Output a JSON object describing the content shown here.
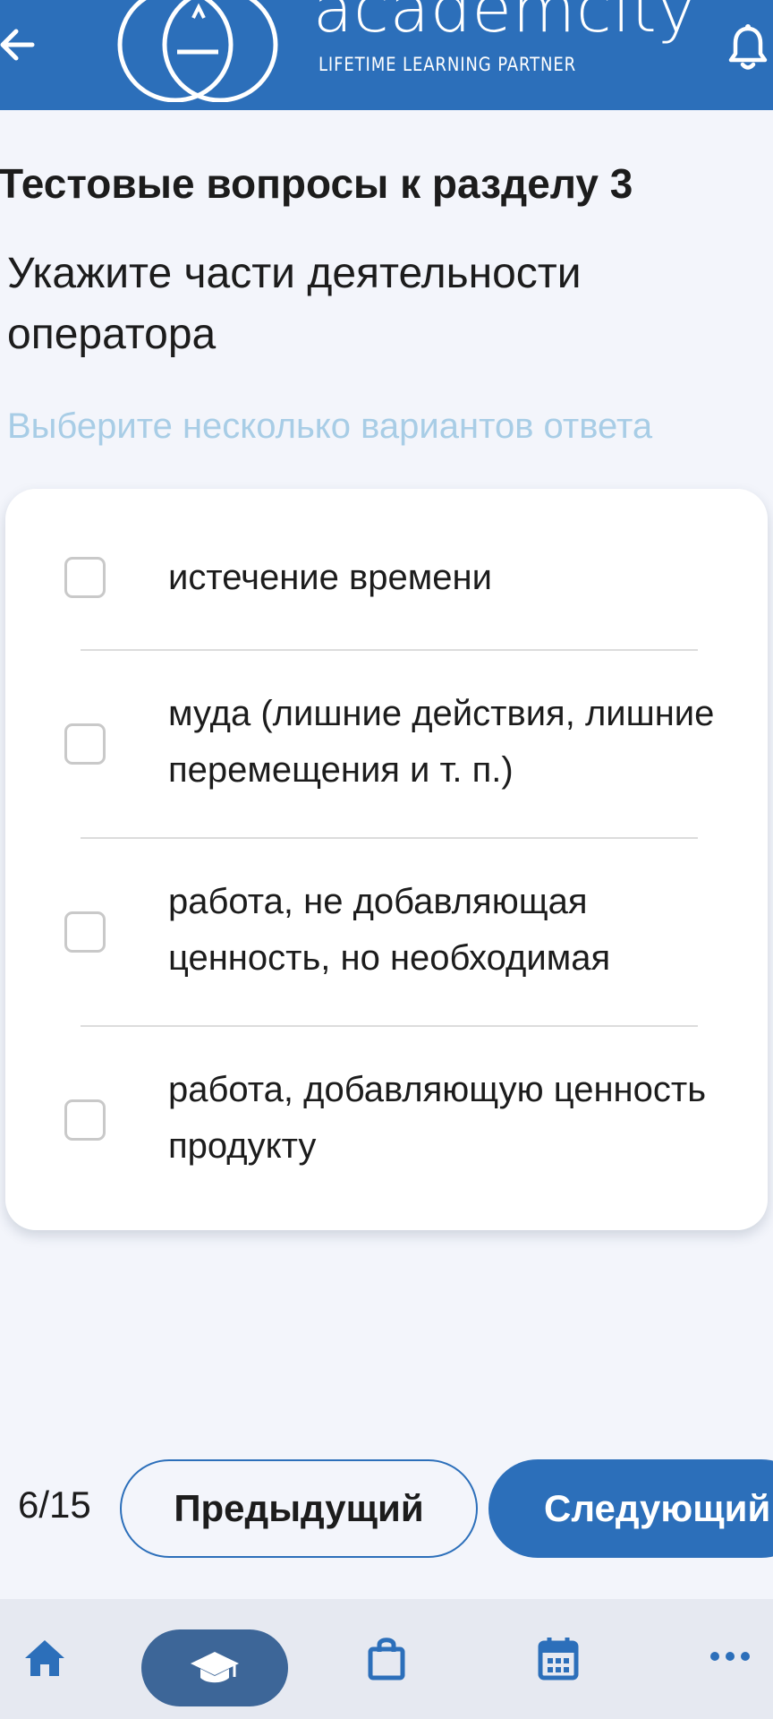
{
  "header": {
    "brand_name": "academcity",
    "brand_tagline": "LIFETIME LEARNING PARTNER",
    "back_icon": "arrow-left-icon",
    "notification_icon": "bell-icon",
    "background_color": "#2c6fba"
  },
  "quiz": {
    "section_title": "Тестовые вопросы к разделу 3",
    "question": "Укажите части деятельности оператора",
    "hint": "Выберите несколько вариантов ответа",
    "options": [
      {
        "label": "истечение времени",
        "checked": false
      },
      {
        "label": "муда (лишние действия, лишние перемещения и т. п.)",
        "checked": false
      },
      {
        "label": "работа, не добавляющая ценность, но необходимая",
        "checked": false
      },
      {
        "label": "работа, добавляющую ценность продукту",
        "checked": false
      }
    ]
  },
  "pager": {
    "counter": "6/15",
    "prev_label": "Предыдущий",
    "next_label": "Следующий"
  },
  "bottom_nav": {
    "items": [
      {
        "icon": "home-icon",
        "active": false
      },
      {
        "icon": "graduation-cap-icon",
        "active": true
      },
      {
        "icon": "shopping-bag-icon",
        "active": false
      },
      {
        "icon": "calendar-icon",
        "active": false
      },
      {
        "icon": "more-dots-icon",
        "active": false
      }
    ],
    "active_color": "#3d6698",
    "icon_color": "#2c6fba"
  },
  "colors": {
    "primary": "#2c6fba",
    "hint": "#a8cde6",
    "page_background": "#f3f5fb"
  }
}
